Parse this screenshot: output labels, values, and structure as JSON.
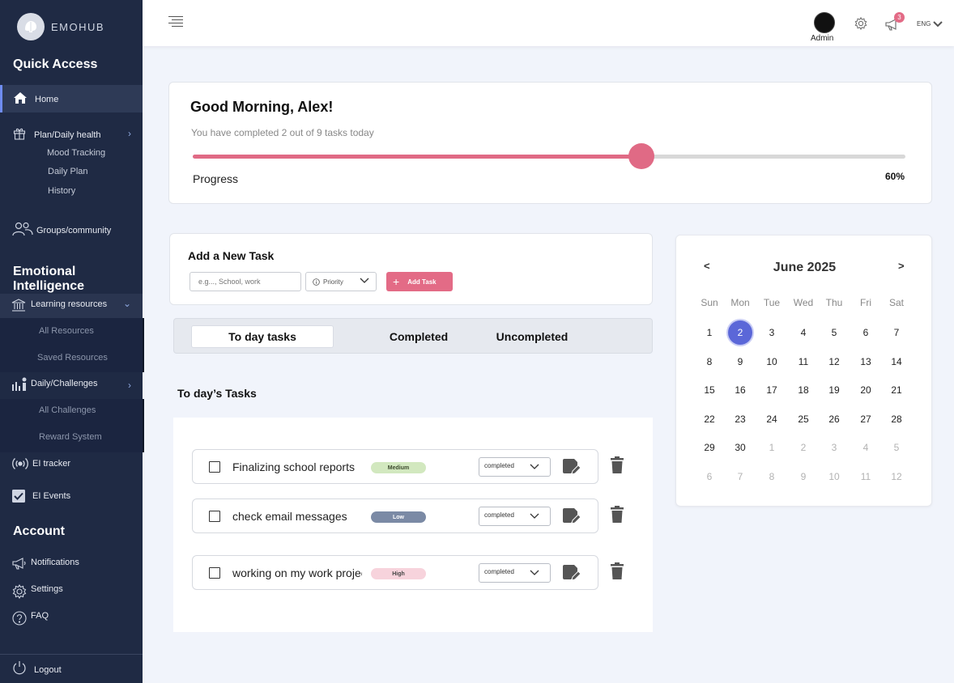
{
  "app": {
    "name": "EMOHUB"
  },
  "sidebar": {
    "sections": {
      "quick_access": "Quick Access",
      "emotional": "Emotional Intelligence",
      "account": "Account"
    },
    "home": "Home",
    "plan": "Plan/Daily health",
    "plan_items": [
      "Mood Tracking",
      "Daily Plan",
      "History"
    ],
    "groups": "Groups/community",
    "learning": "Learning resources",
    "learning_items": [
      "All Resources",
      "Saved Resources"
    ],
    "daily": "Daily/Challenges",
    "daily_items": [
      "All Challenges",
      "Reward System"
    ],
    "tracker": "EI tracker",
    "events": "EI Events",
    "notifications": "Notifications",
    "settings": "Settings",
    "faq": "FAQ",
    "logout": "Logout"
  },
  "topbar": {
    "user": "Admin",
    "notification_count": "3",
    "language": "ENG"
  },
  "greeting": {
    "title": "Good Morning, Alex!",
    "subtitle": "You have completed 2 out of 9 tasks today",
    "progress_label": "Progress",
    "progress_text": "60%",
    "progress_value": 0.63
  },
  "add_task": {
    "title": "Add a New Task",
    "placeholder": "e.g..., School, work",
    "priority_label": "Priority",
    "button_label": "Add Task"
  },
  "tabs": [
    "To day tasks",
    "Completed",
    "Uncompleted"
  ],
  "tasks_title": "To day’s Tasks",
  "tasks": [
    {
      "name": "Finalizing school reports",
      "priority": "Medium",
      "priority_bg": "#d2e8bf",
      "priority_fg": "#3d4a2e",
      "status": "completed"
    },
    {
      "name": "check email messages",
      "priority": "Low",
      "priority_bg": "#7b8aa5",
      "priority_fg": "#ffffff",
      "status": "completed"
    },
    {
      "name": "working on my work project",
      "priority": "High",
      "priority_bg": "#f7d3dc",
      "priority_fg": "#444444",
      "status": "completed"
    }
  ],
  "calendar": {
    "prev": "<",
    "next": ">",
    "title": "June 2025",
    "weekdays": [
      "Sun",
      "Mon",
      "Tue",
      "Wed",
      "Thu",
      "Fri",
      "Sat"
    ],
    "days": [
      [
        "1",
        "2",
        "3",
        "4",
        "5",
        "6",
        "7"
      ],
      [
        "8",
        "9",
        "10",
        "11",
        "12",
        "13",
        "14"
      ],
      [
        "15",
        "16",
        "17",
        "18",
        "19",
        "20",
        "21"
      ],
      [
        "22",
        "23",
        "24",
        "25",
        "26",
        "27",
        "28"
      ],
      [
        "29",
        "30",
        "1",
        "2",
        "3",
        "4",
        "5"
      ],
      [
        "6",
        "7",
        "8",
        "9",
        "10",
        "11",
        "12"
      ]
    ],
    "selected": "2",
    "colors": {
      "selected": "#5b67d8"
    }
  },
  "colors": {
    "sidebar": "#1f2a44",
    "accent": "#e06a85"
  }
}
